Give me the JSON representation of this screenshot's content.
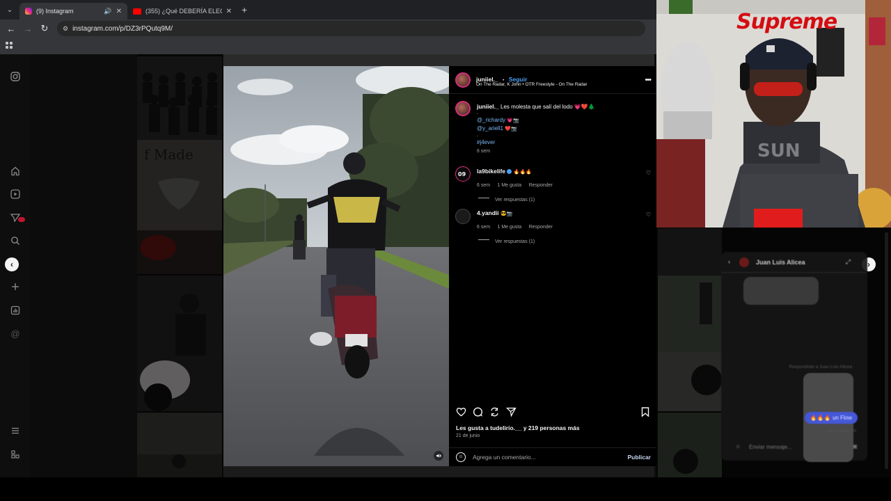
{
  "browser": {
    "tabs": [
      {
        "title": "(9) Instagram",
        "active": true
      },
      {
        "title": "(355) ¿Qué DEBERÍA ELEGIR? 🤯",
        "active": false
      }
    ],
    "new_tab": "+",
    "url": "instagram.com/p/DZ3rPQutq9M/"
  },
  "post": {
    "author": "juniiel._",
    "separator": "•",
    "follow_label": "Seguir",
    "audio": "On The Radar, K John • OTR Freestyle - On The Radar",
    "more": "•••",
    "caption_user": "juniiel._",
    "caption_text": "Les molesta que salí del lodo 💗❤️🌲",
    "caption_dot": ".",
    "caption_mentions": [
      {
        "tag": "@_richardy",
        "emoji": "💗📷"
      },
      {
        "tag": "@y_ariell1",
        "emoji": "❤️📷"
      }
    ],
    "caption_dot2": ".",
    "hashtag": "#j4ever",
    "caption_age": "6 sem",
    "comments": [
      {
        "user": "la9bikelife",
        "text": "🔥🔥🔥",
        "age": "6 sem",
        "likes": "1 Me gusta",
        "reply": "Responder",
        "view_replies": "Ver respuestas (1)"
      },
      {
        "user": "4.yandii",
        "text": "😎📷",
        "age": "6 sem",
        "likes": "1 Me gusta",
        "reply": "Responder",
        "view_replies": "Ver respuestas (1)"
      }
    ],
    "likes_text": "Les gusta a tudelirio.__ y 219 personas más",
    "date": "21 de junio",
    "comment_placeholder": "Agrega un comentario...",
    "publish_label": "Publicar"
  },
  "chat": {
    "name": "Juan Luis Alicea",
    "reply_note": "Respondiste a Juan Luis Alicea",
    "blue_msg": "🔥🔥🔥 un Flow",
    "seen": "Visto Hace 2 h",
    "input_placeholder": "Enviar mensaje..."
  },
  "webcam": {
    "sign": "Supreme"
  },
  "colors": {
    "ig_blue": "#4a9ff5",
    "link_blue": "#7ab7f5",
    "supreme_red": "#d40d12",
    "notif_red": "#c0152f"
  },
  "icons": [
    "instagram-icon",
    "home-icon",
    "reels-icon",
    "messages-icon",
    "search-icon",
    "create-icon",
    "dashboard-icon",
    "threads-icon",
    "menu-icon",
    "more-icon",
    "heart-icon",
    "comment-icon",
    "repost-icon",
    "share-icon",
    "bookmark-icon",
    "emoji-icon",
    "mute-icon",
    "chevron-left-icon",
    "chevron-right-icon"
  ]
}
